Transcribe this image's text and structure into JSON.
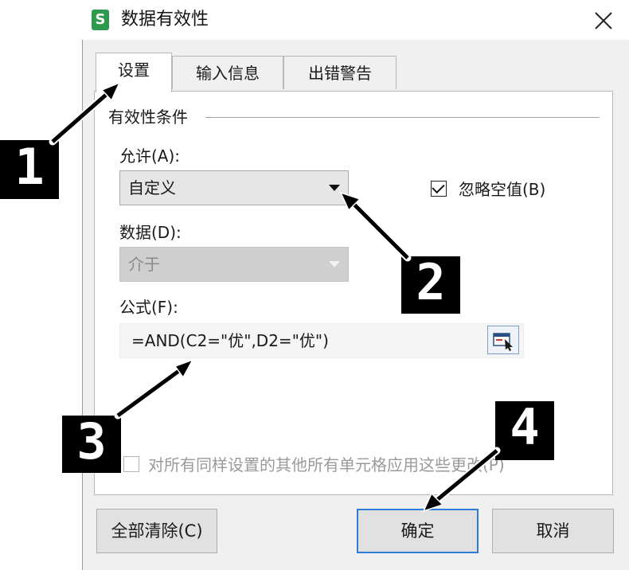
{
  "window": {
    "title": "数据有效性",
    "app_icon_letter": "S"
  },
  "tabs": [
    {
      "label": "设置"
    },
    {
      "label": "输入信息"
    },
    {
      "label": "出错警告"
    }
  ],
  "settings": {
    "group_label": "有效性条件",
    "allow_label": "允许(A):",
    "allow_value": "自定义",
    "ignore_blank_label": "忽略空值(B)",
    "ignore_blank_checked": true,
    "data_label": "数据(D):",
    "data_value": "介于",
    "formula_label": "公式(F):",
    "formula_value": "=AND(C2=\"优\",D2=\"优\")",
    "apply_all_label": "对所有同样设置的其他所有单元格应用这些更改(P)",
    "apply_all_checked": false
  },
  "buttons": {
    "clear_all": "全部清除(C)",
    "ok": "确定",
    "cancel": "取消"
  },
  "annotations": [
    {
      "number": "1"
    },
    {
      "number": "2"
    },
    {
      "number": "3"
    },
    {
      "number": "4"
    }
  ]
}
